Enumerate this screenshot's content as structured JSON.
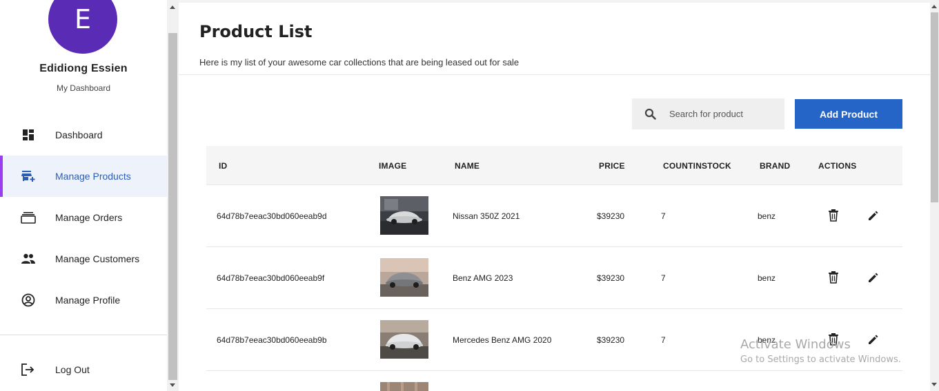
{
  "sidebar": {
    "avatar_letter": "E",
    "user_name": "Edidiong Essien",
    "subtitle": "My Dashboard",
    "items": [
      {
        "label": "Dashboard",
        "icon": "dashboard-icon"
      },
      {
        "label": "Manage Products",
        "icon": "store-add-icon",
        "active": true
      },
      {
        "label": "Manage Orders",
        "icon": "orders-icon"
      },
      {
        "label": "Manage Customers",
        "icon": "people-icon"
      },
      {
        "label": "Manage Profile",
        "icon": "account-circle-icon"
      }
    ],
    "logout_label": "Log Out",
    "accent_color": "#9b3df0",
    "avatar_color": "#5a2bb5"
  },
  "main": {
    "title": "Product List",
    "subtitle": "Here is my list of your awesome car collections that are being leased out for sale",
    "search": {
      "placeholder": "Search for product",
      "value": ""
    },
    "add_button_label": "Add Product",
    "add_button_color": "#2465c7",
    "table": {
      "headers": [
        "ID",
        "IMAGE",
        "NAME",
        "PRICE",
        "COUNTINSTOCK",
        "BRAND",
        "ACTIONS"
      ],
      "rows": [
        {
          "id": "64d78b7eeac30bd060eeab9d",
          "name": "Nissan 350Z 2021",
          "price": "$39230",
          "count": "7",
          "brand": "benz"
        },
        {
          "id": "64d78b7eeac30bd060eeab9f",
          "name": "Benz AMG 2023",
          "price": "$39230",
          "count": "7",
          "brand": "benz"
        },
        {
          "id": "64d78b7eeac30bd060eeab9b",
          "name": "Mercedes Benz AMG 2020",
          "price": "$39230",
          "count": "7",
          "brand": "benz"
        }
      ]
    }
  },
  "watermark": {
    "line1": "Activate Windows",
    "line2": "Go to Settings to activate Windows."
  }
}
